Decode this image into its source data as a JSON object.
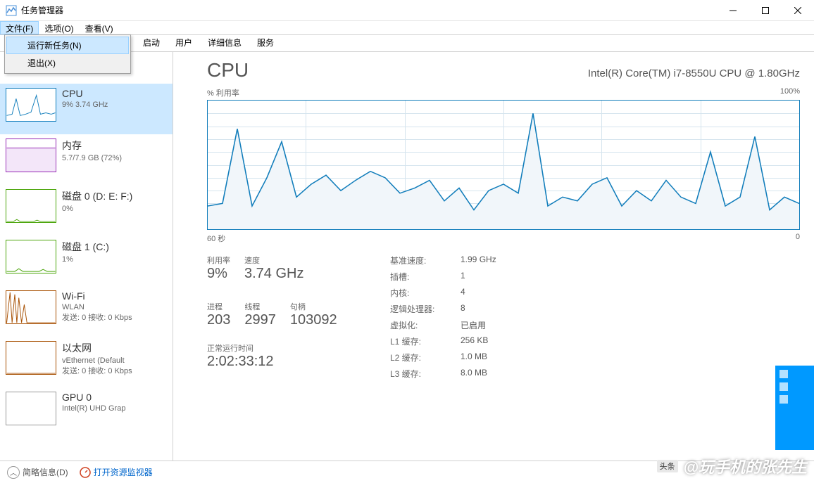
{
  "window": {
    "title": "任务管理器"
  },
  "menubar": {
    "file": "文件(F)",
    "options": "选项(O)",
    "view": "查看(V)"
  },
  "dropdown": {
    "new_task": "运行新任务(N)",
    "exit": "退出(X)"
  },
  "tabs_hidden": {
    "startup": "启动",
    "users": "用户",
    "details": "详细信息",
    "services": "服务"
  },
  "sidebar": {
    "cpu": {
      "label": "CPU",
      "stats": "9%  3.74 GHz"
    },
    "memory": {
      "label": "内存",
      "stats": "5.7/7.9 GB (72%)"
    },
    "disk0": {
      "label": "磁盘 0 (D: E: F:)",
      "stats": "0%"
    },
    "disk1": {
      "label": "磁盘 1 (C:)",
      "stats": "1%"
    },
    "wifi": {
      "label": "Wi-Fi",
      "sublabel": "WLAN",
      "stats": "发送: 0  接收: 0 Kbps"
    },
    "ethernet": {
      "label": "以太网",
      "sublabel": "vEthernet (Default",
      "stats": "发送: 0  接收: 0 Kbps"
    },
    "gpu": {
      "label": "GPU 0",
      "sublabel": "Intel(R) UHD Grap"
    }
  },
  "main": {
    "title": "CPU",
    "subtitle": "Intel(R) Core(TM) i7-8550U CPU @ 1.80GHz",
    "chart_top_left": "% 利用率",
    "chart_top_right": "100%",
    "chart_bottom_left": "60 秒",
    "chart_bottom_right": "0",
    "stats": {
      "utilization_label": "利用率",
      "utilization_value": "9%",
      "speed_label": "速度",
      "speed_value": "3.74 GHz",
      "processes_label": "进程",
      "processes_value": "203",
      "threads_label": "线程",
      "threads_value": "2997",
      "handles_label": "句柄",
      "handles_value": "103092",
      "uptime_label": "正常运行时间",
      "uptime_value": "2:02:33:12"
    },
    "right_stats": {
      "base_speed_label": "基准速度:",
      "base_speed_value": "1.99 GHz",
      "sockets_label": "插槽:",
      "sockets_value": "1",
      "cores_label": "内核:",
      "cores_value": "4",
      "logical_label": "逻辑处理器:",
      "logical_value": "8",
      "virt_label": "虚拟化:",
      "virt_value": "已启用",
      "l1_label": "L1 缓存:",
      "l1_value": "256 KB",
      "l2_label": "L2 缓存:",
      "l2_value": "1.0 MB",
      "l3_label": "L3 缓存:",
      "l3_value": "8.0 MB"
    }
  },
  "statusbar": {
    "fewer": "简略信息(D)",
    "resource_monitor": "打开资源监视器"
  },
  "watermark": {
    "badge": "头条",
    "text": "@玩手机的张先生"
  },
  "chart_data": {
    "type": "line",
    "title": "% 利用率",
    "ylim": [
      0,
      100
    ],
    "xrange_seconds": 60,
    "values": [
      18,
      20,
      78,
      18,
      40,
      68,
      25,
      35,
      42,
      30,
      38,
      45,
      40,
      28,
      32,
      38,
      22,
      32,
      15,
      30,
      35,
      28,
      90,
      18,
      25,
      22,
      35,
      40,
      18,
      30,
      22,
      38,
      25,
      20,
      60,
      18,
      25,
      72,
      15,
      25,
      20
    ]
  }
}
